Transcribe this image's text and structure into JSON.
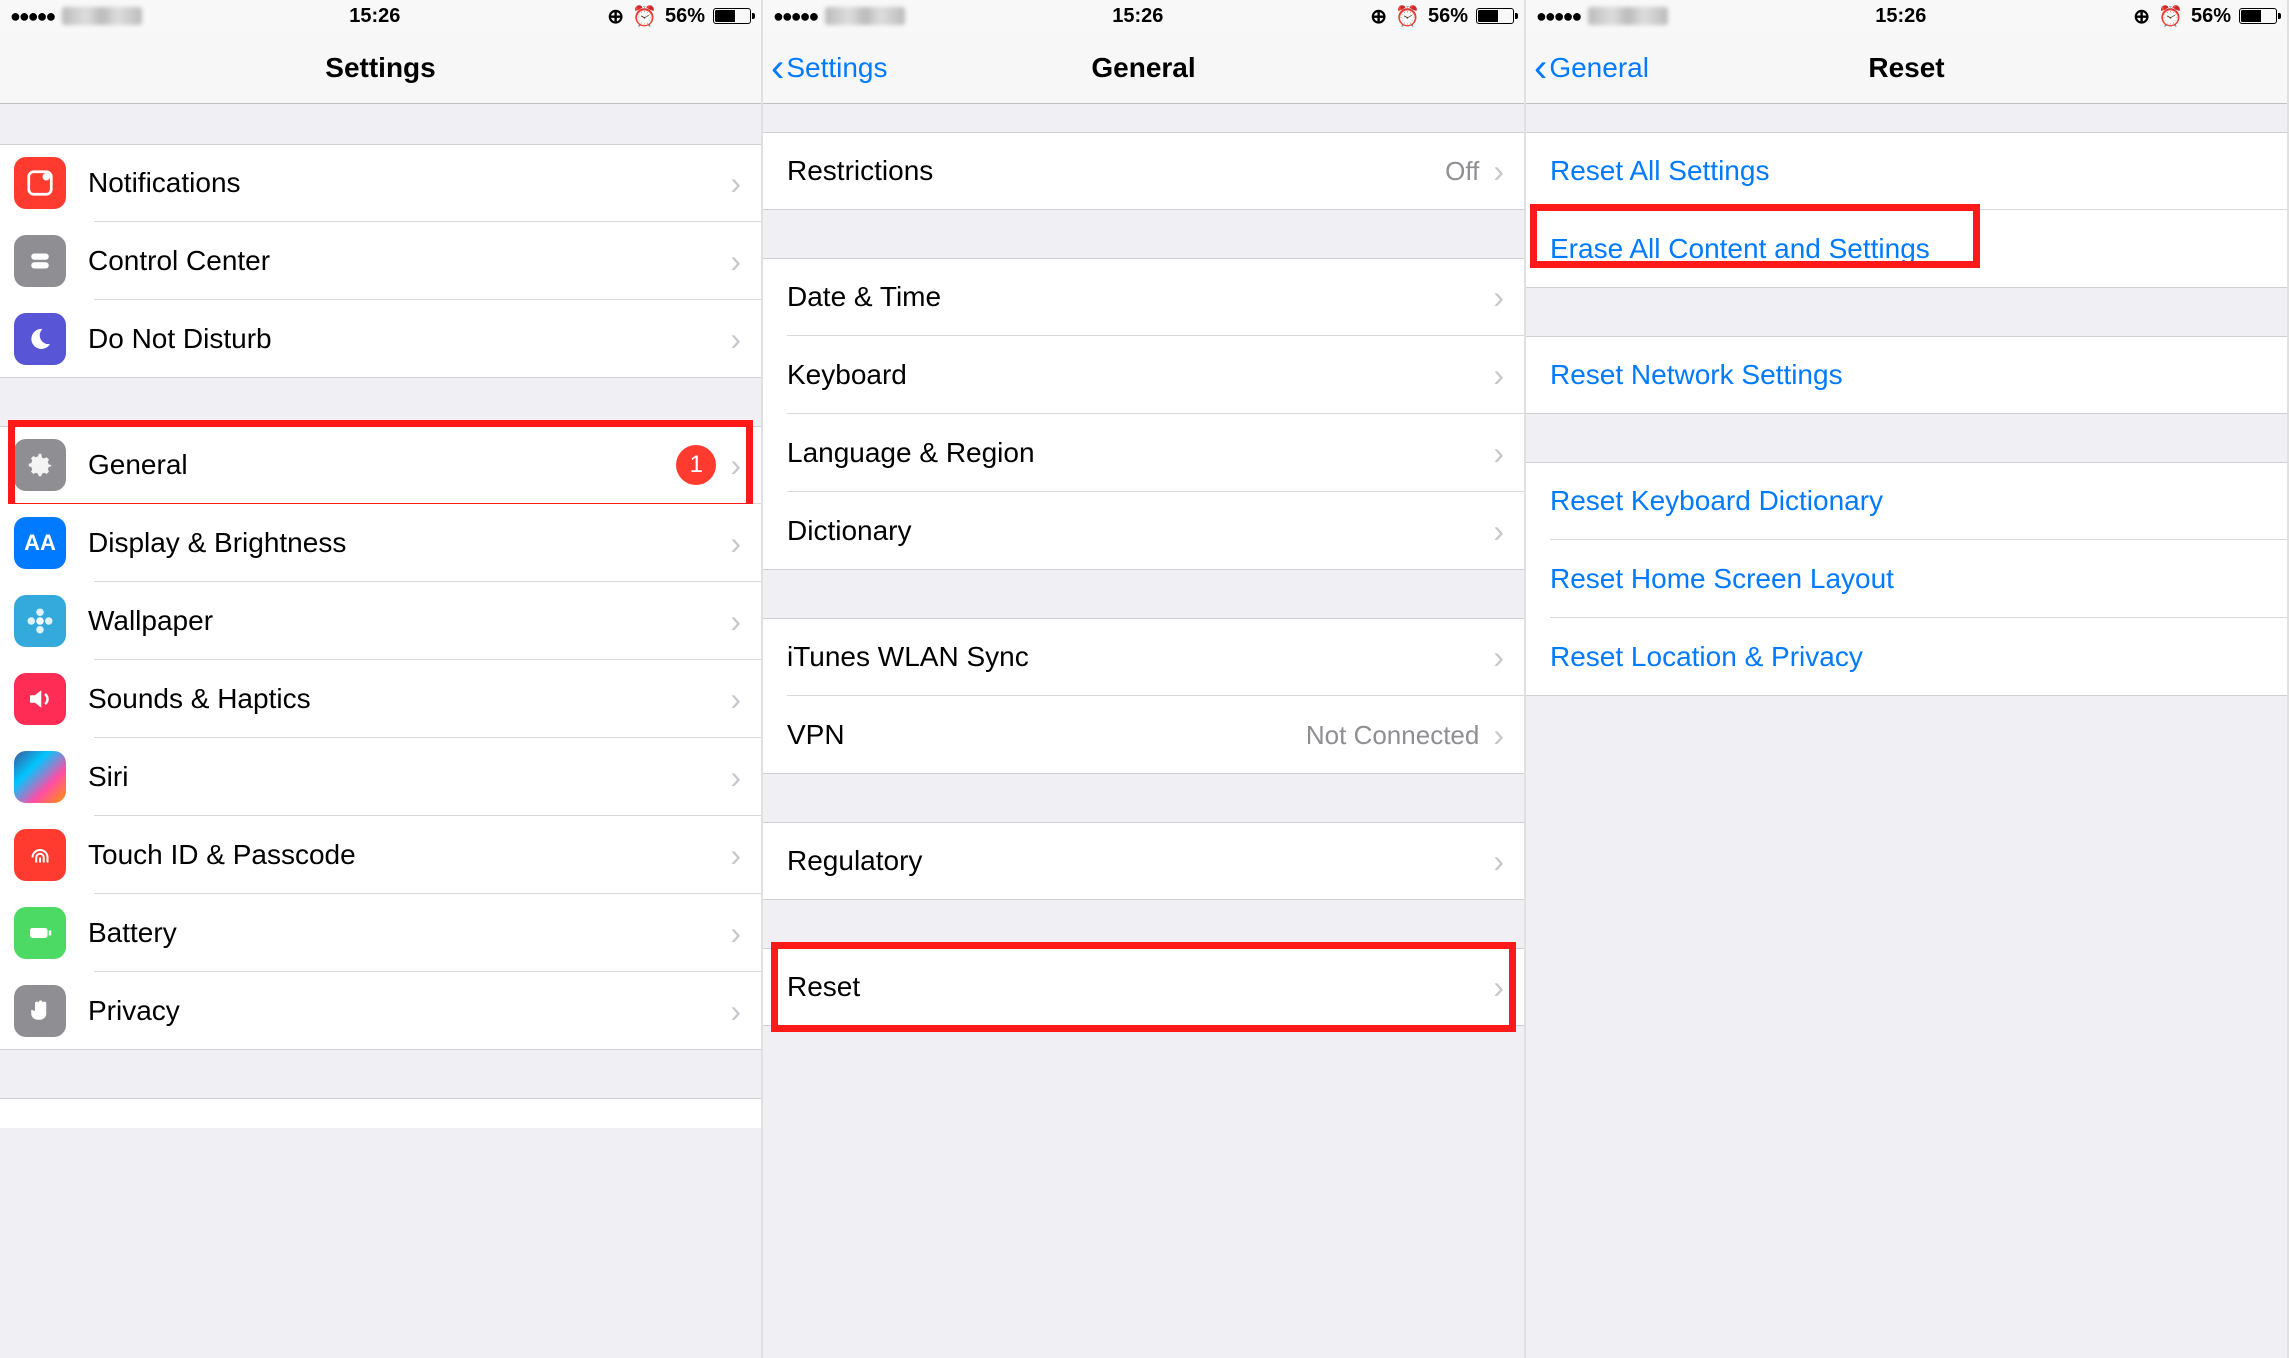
{
  "status": {
    "time": "15:26",
    "battery": "56%",
    "signal": "●●●●●"
  },
  "s1": {
    "title": "Settings",
    "items": {
      "notifications": "Notifications",
      "control_center": "Control Center",
      "dnd": "Do Not Disturb",
      "general": "General",
      "general_badge": "1",
      "display": "Display & Brightness",
      "wallpaper": "Wallpaper",
      "sounds": "Sounds & Haptics",
      "siri": "Siri",
      "touchid": "Touch ID & Passcode",
      "battery": "Battery",
      "privacy": "Privacy"
    }
  },
  "s2": {
    "back": "Settings",
    "title": "General",
    "items": {
      "restrictions": "Restrictions",
      "restrictions_val": "Off",
      "date_time": "Date & Time",
      "keyboard": "Keyboard",
      "lang_region": "Language & Region",
      "dictionary": "Dictionary",
      "itunes_sync": "iTunes WLAN Sync",
      "vpn": "VPN",
      "vpn_val": "Not Connected",
      "regulatory": "Regulatory",
      "reset": "Reset"
    }
  },
  "s3": {
    "back": "General",
    "title": "Reset",
    "items": {
      "reset_all": "Reset All Settings",
      "erase_all": "Erase All Content and Settings",
      "reset_net": "Reset Network Settings",
      "reset_kbd": "Reset Keyboard Dictionary",
      "reset_home": "Reset Home Screen Layout",
      "reset_loc": "Reset Location & Privacy"
    }
  }
}
